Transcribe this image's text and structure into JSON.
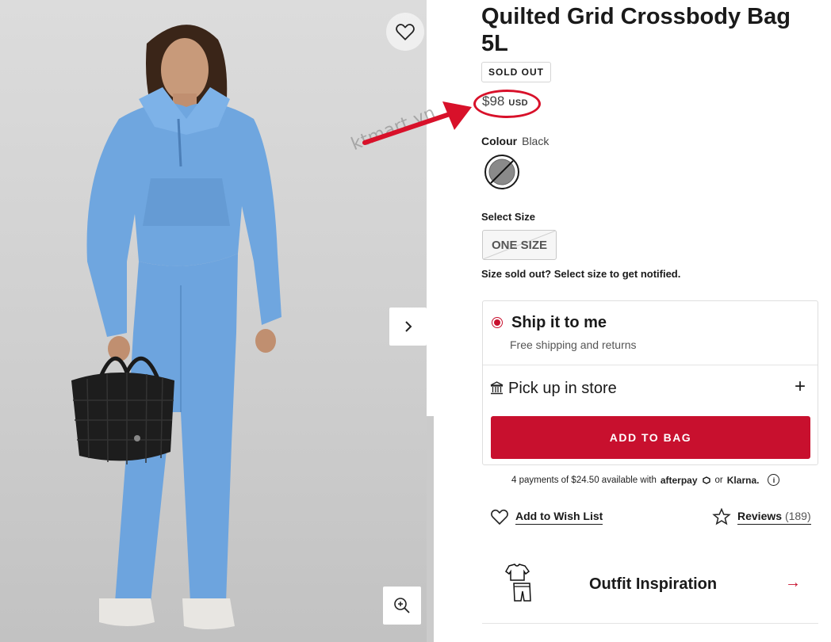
{
  "product": {
    "title": "Quilted Grid Crossbody Bag 5L",
    "status_badge": "SOLD OUT",
    "price": "$98",
    "currency": "USD"
  },
  "watermark": "ktmart.vn",
  "colour": {
    "label": "Colour",
    "selected": "Black"
  },
  "size": {
    "label": "Select Size",
    "option": "ONE SIZE",
    "note": "Size sold out? Select size to get notified."
  },
  "shipping": {
    "ship_title": "Ship it to me",
    "ship_subtitle": "Free shipping and returns",
    "pickup_label": "Pick up in store",
    "expand_symbol": "+"
  },
  "cta": {
    "add_to_bag": "ADD TO BAG"
  },
  "installments": {
    "text": "4 payments of $24.50 available with",
    "provider1": "afterpay",
    "or": "or",
    "provider2": "Klarna."
  },
  "actions": {
    "wishlist": "Add to Wish List",
    "reviews": "Reviews",
    "reviews_count": "(189)"
  },
  "outfit": {
    "label": "Outfit Inspiration",
    "arrow": "→"
  },
  "icons": {
    "wishlist": "heart-icon",
    "next": "chevron-right-icon",
    "zoom": "zoom-in-icon",
    "store": "store-icon",
    "star": "star-icon",
    "info": "info-icon",
    "outfit": "outfit-icon"
  },
  "colors": {
    "accent": "#c8102e",
    "annotation": "#d8112a",
    "text": "#1a1a1a"
  }
}
